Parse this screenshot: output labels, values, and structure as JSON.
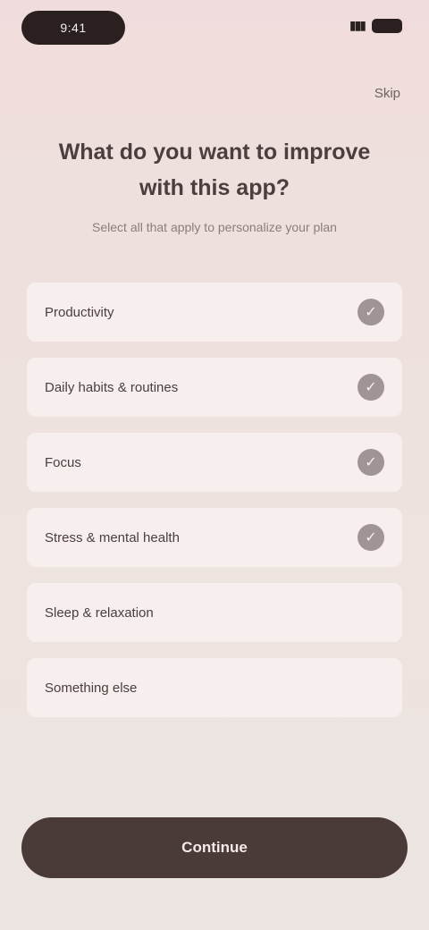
{
  "status_bar": {
    "time": "9:41",
    "signal": "▮▮▮"
  },
  "header": {
    "skip_label": "Skip"
  },
  "title": "What do you want to improve with this app?",
  "subtitle": "Select all that apply to personalize your plan",
  "options": [
    {
      "label": "Productivity",
      "selected": true
    },
    {
      "label": "Daily habits & routines",
      "selected": true
    },
    {
      "label": "Focus",
      "selected": true
    },
    {
      "label": "Stress & mental health",
      "selected": true
    },
    {
      "label": "Sleep & relaxation",
      "selected": false
    },
    {
      "label": "Something else",
      "selected": false
    }
  ],
  "check_glyph": "✓",
  "footer": {
    "continue_label": "Continue"
  }
}
